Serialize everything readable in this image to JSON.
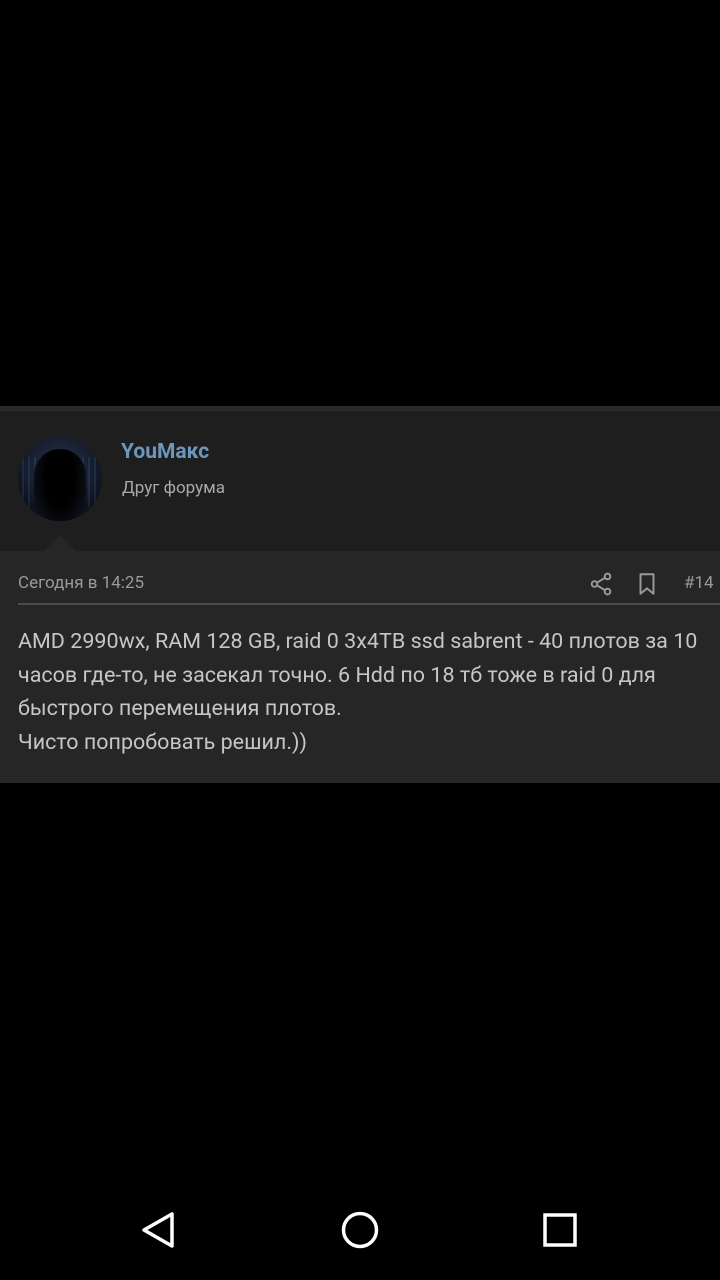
{
  "post": {
    "author": {
      "name": "YouМакс",
      "title": "Друг форума",
      "avatar_icon": "hooded-figure-avatar"
    },
    "meta": {
      "date": "Сегодня в 14:25",
      "number": "#14",
      "share_icon": "share-icon",
      "bookmark_icon": "bookmark-icon"
    },
    "message": "AMD 2990wx, RAM 128 GB, raid 0 3x4TB ssd sabrent - 40 плотов за 10 часов где-то, не засекал точно. 6 Hdd по 18 тб тоже в raid 0 для быстрого перемещения плотов.\nЧисто попробовать решил.))"
  },
  "navigation": {
    "back_icon": "back-triangle-icon",
    "home_icon": "home-circle-icon",
    "recents_icon": "recents-square-icon"
  },
  "colors": {
    "background": "#000000",
    "post_header_bg": "#1e1e1e",
    "post_body_bg": "#262626",
    "author_name": "#6c97bd",
    "text": "#c6c6c6",
    "muted_text": "#9a9a9a"
  }
}
